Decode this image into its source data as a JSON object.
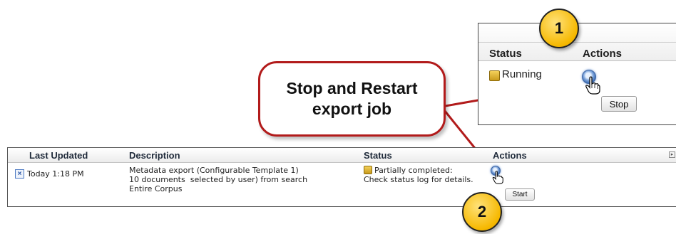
{
  "top_panel": {
    "col_status": "Status",
    "col_actions": "Actions",
    "status_value": "Running",
    "stop_label": "Stop"
  },
  "callout": {
    "line1": "Stop and Restart",
    "line2": "export job"
  },
  "badges": {
    "one": "1",
    "two": "2"
  },
  "table": {
    "headers": {
      "last_updated": "Last Updated",
      "description": "Description",
      "status": "Status",
      "actions": "Actions"
    },
    "row": {
      "last_updated": "Today 1:18 PM",
      "description_line1": "Metadata export (Configurable Template 1)",
      "description_line2": "10 documents  selected by user) from search",
      "description_line3": "Entire Corpus",
      "status_line1": "Partially completed:",
      "status_line2": "Check status log for details.",
      "start_label": "Start",
      "remove_glyph": "×"
    }
  },
  "colors": {
    "callout_border": "#b21b1b",
    "connector": "#b21b1b",
    "badge_fill": "#f6b800",
    "action_button": "#3f6fb6",
    "status_icon": "#e0b52e"
  },
  "icons": [
    "status-pending-icon",
    "hand-cursor-icon",
    "remove-x-icon",
    "expand-icon"
  ]
}
